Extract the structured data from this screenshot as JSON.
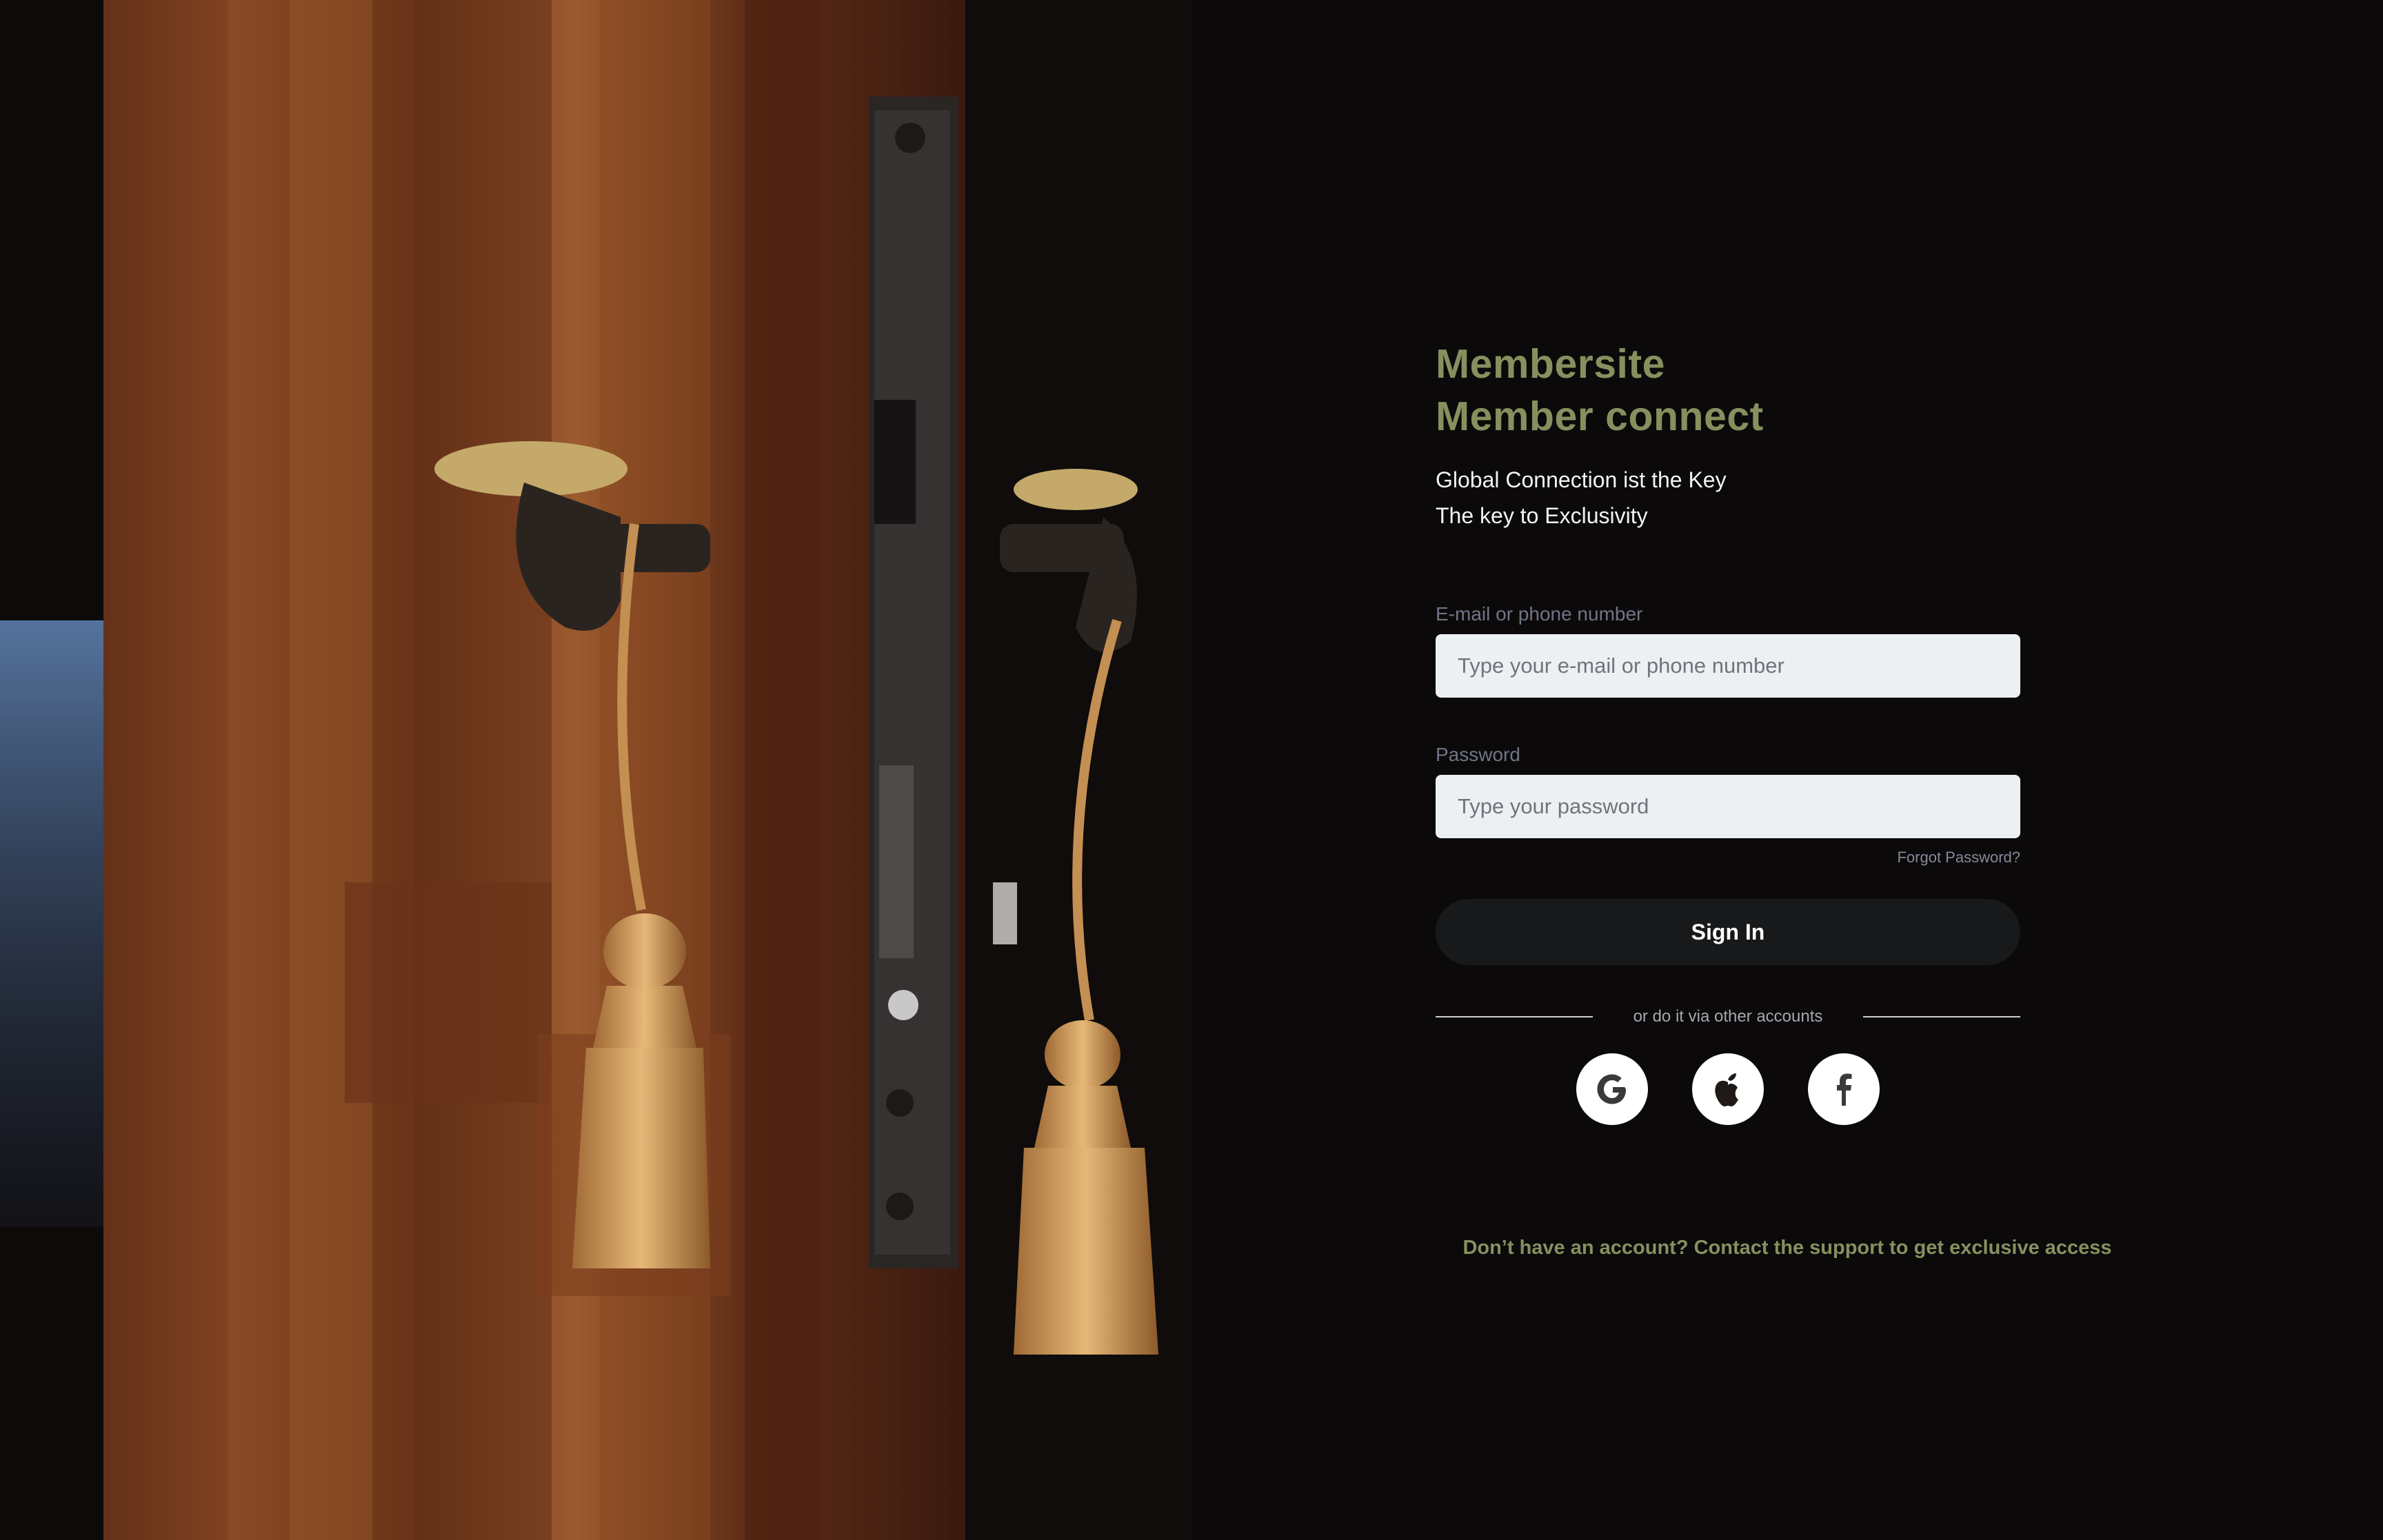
{
  "brand": {
    "line1": "Membersite",
    "line2": "Member connect"
  },
  "tagline": {
    "line1": "Global Connection ist the Key",
    "line2": "The key to Exclusivity"
  },
  "form": {
    "email_label": "E-mail or phone number",
    "email_placeholder": "Type your e-mail or phone number",
    "email_value": "",
    "password_label": "Password",
    "password_placeholder": "Type your password",
    "password_value": "",
    "forgot_label": "Forgot Password?",
    "signin_label": "Sign In",
    "divider_text": "or do it via other accounts"
  },
  "socials": [
    {
      "name": "google",
      "icon": "google-icon"
    },
    {
      "name": "apple",
      "icon": "apple-icon"
    },
    {
      "name": "facebook",
      "icon": "facebook-icon"
    }
  ],
  "footer": {
    "text": "Don’t have an account? Contact the support to get exclusive access"
  },
  "colors": {
    "background": "#0c090a",
    "accent": "#86905f",
    "input_bg": "#edf0f3",
    "button_bg": "#17191b",
    "label": "#6f7686"
  },
  "hero_image": {
    "subject": "wooden-door-with-keys-and-tassels"
  }
}
